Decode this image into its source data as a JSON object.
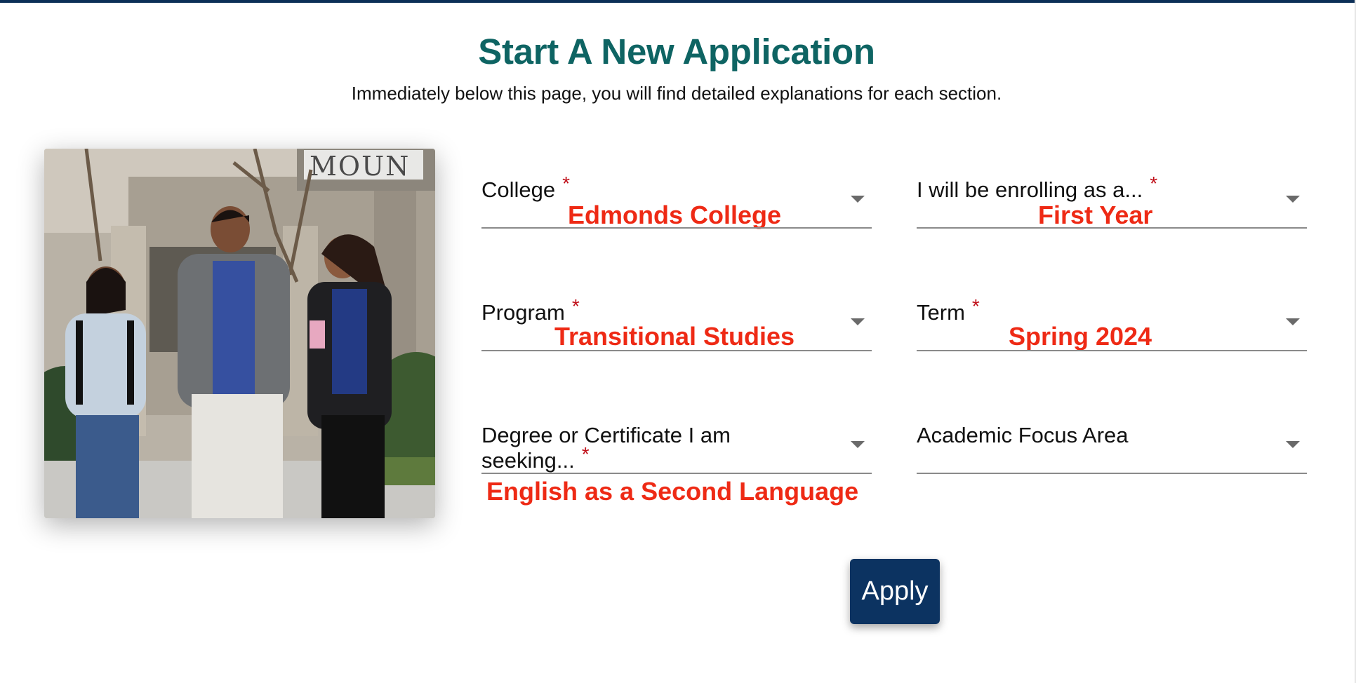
{
  "header": {
    "title": "Start A New Application",
    "subtitle": "Immediately below this page, you will find detailed explanations for each section."
  },
  "image": {
    "sign_text": "MOUN",
    "description_icon": "students-walking-photo"
  },
  "form": {
    "college": {
      "label": "College",
      "required": "*",
      "value": "Edmonds College"
    },
    "enrolling_as": {
      "label": "I will be enrolling as a...",
      "required": "*",
      "value": "First Year"
    },
    "program": {
      "label": "Program",
      "required": "*",
      "value": "Transitional Studies"
    },
    "term": {
      "label": "Term",
      "required": "*",
      "value": "Spring 2024"
    },
    "degree": {
      "label_line1": "Degree or Certificate I am",
      "label_line2": "seeking...",
      "required": "*",
      "value": "English as a Second Language"
    },
    "focus_area": {
      "label": "Academic Focus Area",
      "value": ""
    },
    "apply_label": "Apply"
  },
  "colors": {
    "title": "#0e6463",
    "annotation": "#ee2a15",
    "required": "#c0101a",
    "button": "#0c3361",
    "top_rule": "#0c2f57"
  }
}
